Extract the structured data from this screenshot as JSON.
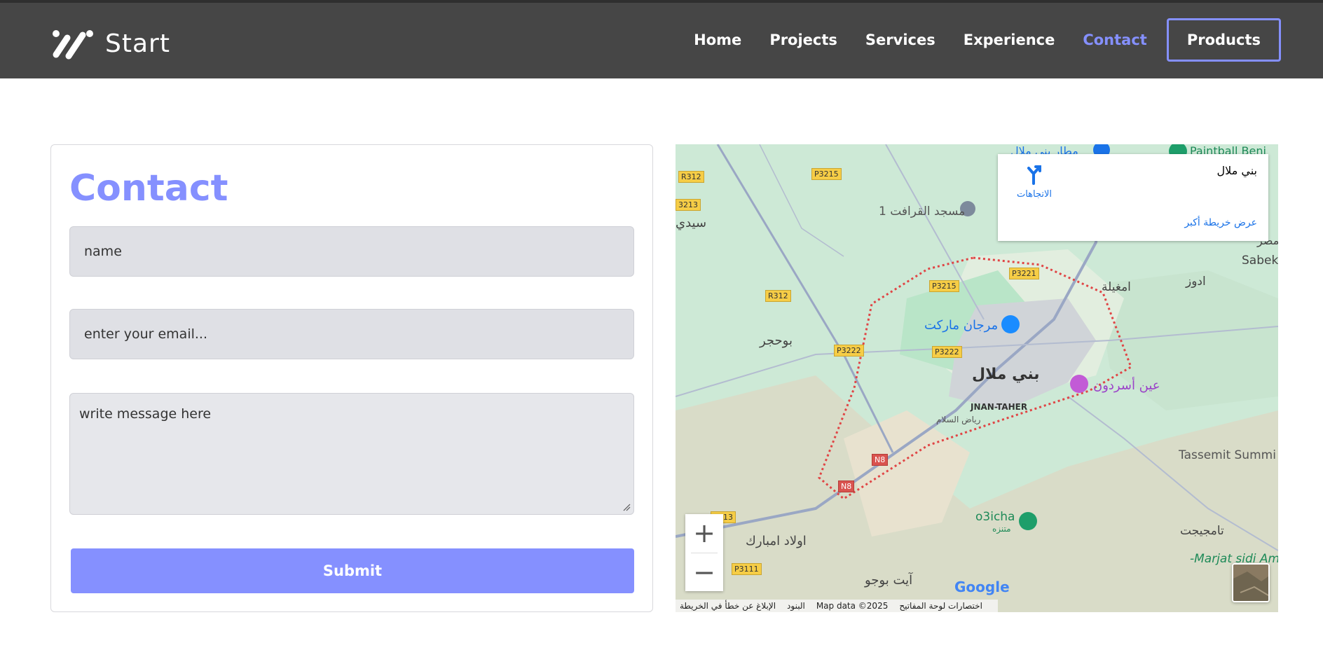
{
  "header": {
    "brand_name": "Start",
    "nav": [
      "Home",
      "Projects",
      "Services",
      "Experience",
      "Contact"
    ],
    "active_nav": "Contact",
    "products_label": "Products"
  },
  "contact": {
    "title": "Contact",
    "name_placeholder": "name",
    "email_placeholder": "enter your email...",
    "message_placeholder": "write message here",
    "submit_label": "Submit"
  },
  "map": {
    "info_title": "بني ملال",
    "directions_label": "الاتجاهات",
    "view_larger_label": "عرض خريطة أكبر",
    "zoom_in": "+",
    "zoom_out": "−",
    "google_logo": "Google",
    "footer": {
      "shortcuts": "اختصارات لوحة المفاتيح",
      "map_data": "Map data ©2025",
      "terms": "البنود",
      "report": "الإبلاغ عن خطأ في الخريطة"
    },
    "places": {
      "beni_mellal": "بني ملال",
      "jnan_taher": "JNAN-TAHER",
      "riad_salam": "رياض السلام",
      "marjane": "مرجان ماركت",
      "ain_asserdoun": "عين أسردون",
      "mosque": "مسجد القرافت 1",
      "oulad_mbarek": "اولاد امبارك",
      "ait_bouguemez": "آيت بوجو",
      "bouhajjar": "بوحجر",
      "sidi": "سيدي",
      "o3icha": "o3icha",
      "o3icha_ar": "متنزه",
      "tassemit": "Tassemit Summi",
      "tamjiijt": "تامجيجت",
      "marjat": "-Marjat sidi Am",
      "sabek": "Sabek",
      "adouz": "ادوز",
      "amghila": "امغيلة",
      "paintball": "Paintball Beni",
      "masr": "مصر",
      "top_label": "مطار بني ملال"
    },
    "roads": {
      "r312a": "R312",
      "r312b": "R312",
      "p3215a": "P3215",
      "p3215b": "P3215",
      "p3213a": "3213",
      "p3213b": "3213",
      "p3221": "P3221",
      "p3222a": "P3222",
      "p3222b": "P3222",
      "n8a": "N8",
      "n8b": "N8",
      "p3111": "P3111"
    }
  }
}
